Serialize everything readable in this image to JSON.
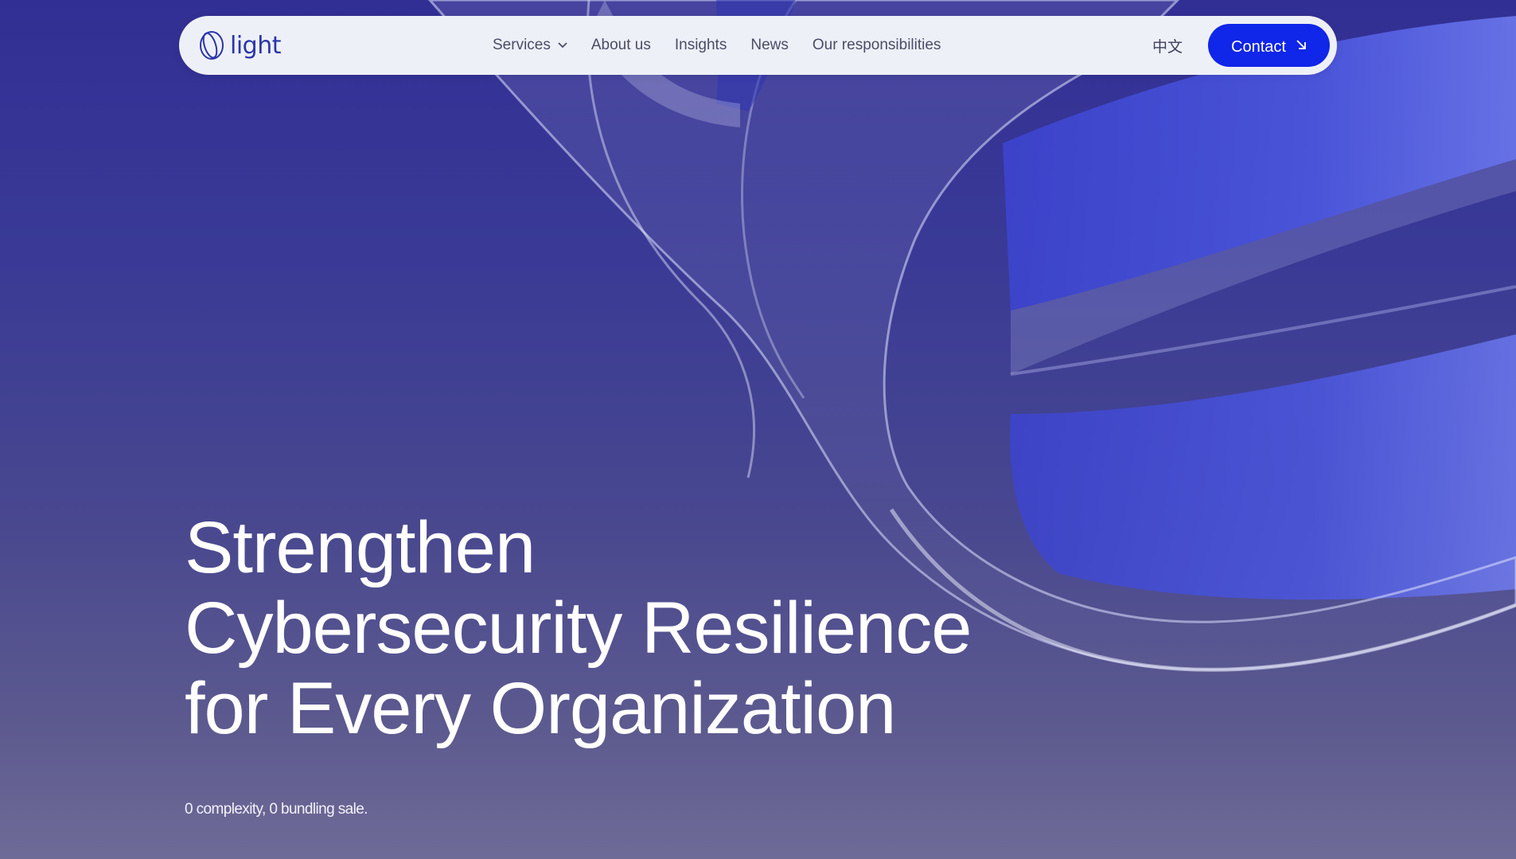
{
  "brand": {
    "name": "light",
    "logo_icon": "ring-logo-icon",
    "color": "#2a35a8"
  },
  "nav": {
    "items": [
      {
        "label": "Services",
        "has_dropdown": true,
        "icon": "chevron-down-icon"
      },
      {
        "label": "About us"
      },
      {
        "label": "Insights"
      },
      {
        "label": "News"
      },
      {
        "label": "Our responsibilities"
      }
    ],
    "language_label": "中文",
    "contact_label": "Contact",
    "contact_icon": "arrow-down-right-icon"
  },
  "hero": {
    "title_lines": [
      "Strengthen",
      "Cybersecurity Resilience",
      "for Every Organization"
    ],
    "subtitle": "0 complexity, 0 bundling sale."
  },
  "colors": {
    "accent": "#1026e8",
    "nav_background": "#eef0f8",
    "hero_background_top": "#322f94",
    "hero_background_bottom": "#6f6b97",
    "ribbon_blue": "#3a44d6"
  }
}
